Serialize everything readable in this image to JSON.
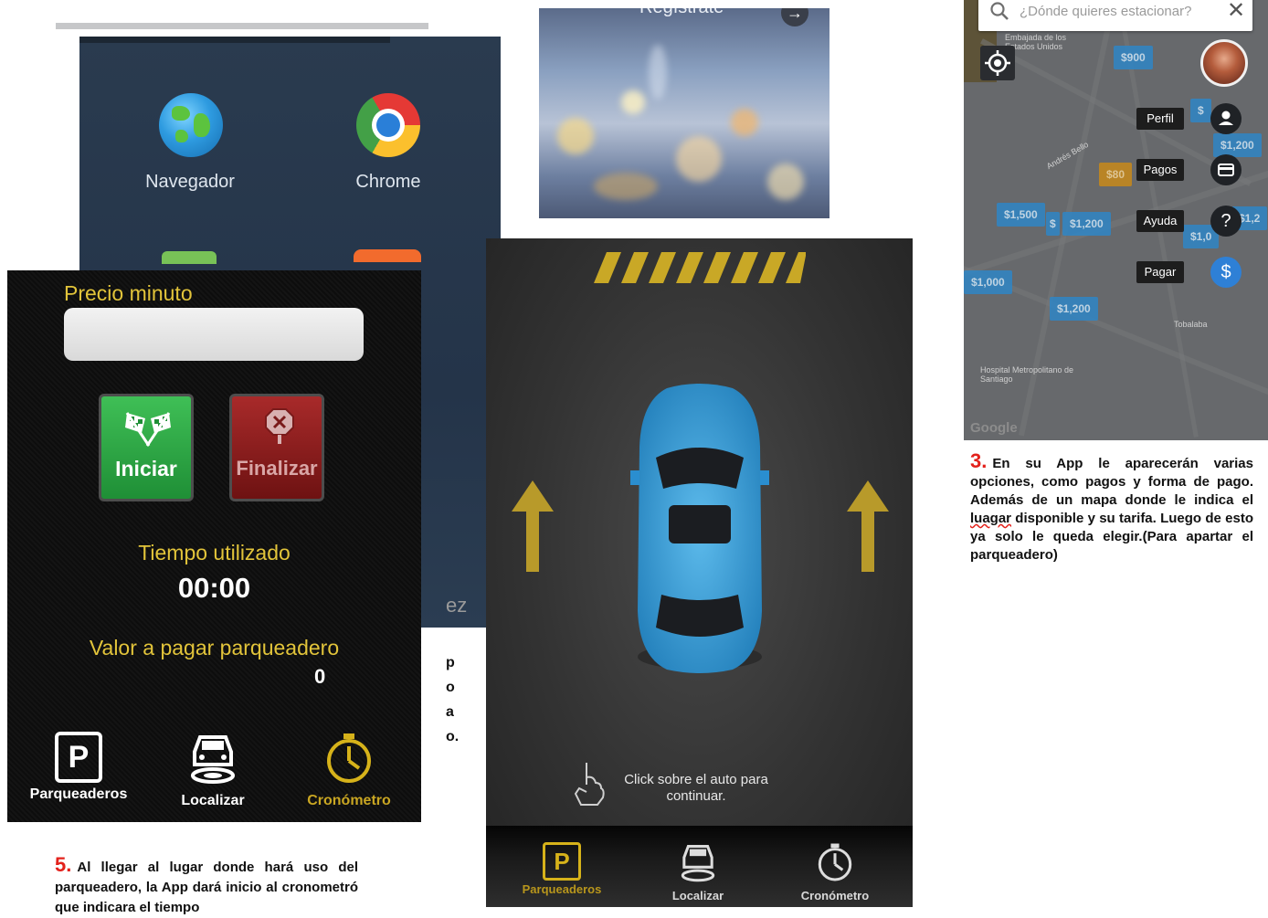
{
  "launcher": {
    "apps": [
      {
        "label": "Navegador",
        "icon": "globe-icon"
      },
      {
        "label": "Chrome",
        "icon": "chrome-icon"
      }
    ],
    "cut_text": "ez",
    "side_chars": [
      "p",
      "o",
      "a",
      "o."
    ]
  },
  "blurred_screen": {
    "title": "Regístrate",
    "arrow": "→"
  },
  "crono_screen": {
    "price_label": "Precio minuto",
    "price_value": "",
    "start_button": "Iniciar",
    "stop_button": "Finalizar",
    "time_label": "Tiempo utilizado",
    "time_value": "00:00",
    "pay_label": "Valor a pagar parqueadero",
    "pay_value": "0",
    "nav": [
      {
        "label": "Parqueaderos",
        "icon": "parking-icon",
        "active": false
      },
      {
        "label": "Localizar",
        "icon": "car-locate-icon",
        "active": false
      },
      {
        "label": "Cronómetro",
        "icon": "stopwatch-icon",
        "active": true
      }
    ]
  },
  "car_screen": {
    "hint": "Click sobre el auto para continuar.",
    "car_color": "#3ea6e0",
    "nav": [
      {
        "label": "Parqueaderos",
        "icon": "parking-icon",
        "active": true
      },
      {
        "label": "Localizar",
        "icon": "car-locate-icon",
        "active": false
      },
      {
        "label": "Cronómetro",
        "icon": "stopwatch-icon",
        "active": false
      }
    ]
  },
  "map_screen": {
    "search_placeholder": "¿Dónde quieres estacionar?",
    "prices": [
      "$900",
      "$1,200",
      "$80",
      "$1,500",
      "$1,200",
      "$1,000",
      "$1,200",
      "$1,0",
      "$",
      "$",
      "$1,2"
    ],
    "menu": [
      {
        "label": "Perfil",
        "icon": "person-icon"
      },
      {
        "label": "Pagos",
        "icon": "card-icon"
      },
      {
        "label": "Ayuda",
        "icon": "help-icon"
      },
      {
        "label": "Pagar",
        "icon": "dollar-icon"
      }
    ],
    "map_labels": [
      "Embajada de los Estados Unidos",
      "Tobalaba",
      "Hospital Metropolitano de Santiago",
      "Andrés Bello"
    ],
    "logo": "Google"
  },
  "step3": {
    "number": "3.",
    "text_before": "En su App le aparecerán varias opciones, como pagos y forma de pago. Además de un mapa donde le indica el ",
    "misspelled": "luagar",
    "text_after": " disponible y su tarifa. Luego de esto ya solo le queda elegir.(Para apartar el parqueadero)"
  },
  "step5": {
    "number": "5.",
    "text": "Al llegar al lugar donde hará uso del parqueadero, la App dará inicio al cronometró que indicara el tiempo"
  },
  "colors": {
    "accent_yellow": "#e2c43a",
    "step_red": "#e3211b",
    "map_blue": "#2f86c6",
    "start_green": "#2aa043",
    "stop_red": "#8a1c1c"
  }
}
